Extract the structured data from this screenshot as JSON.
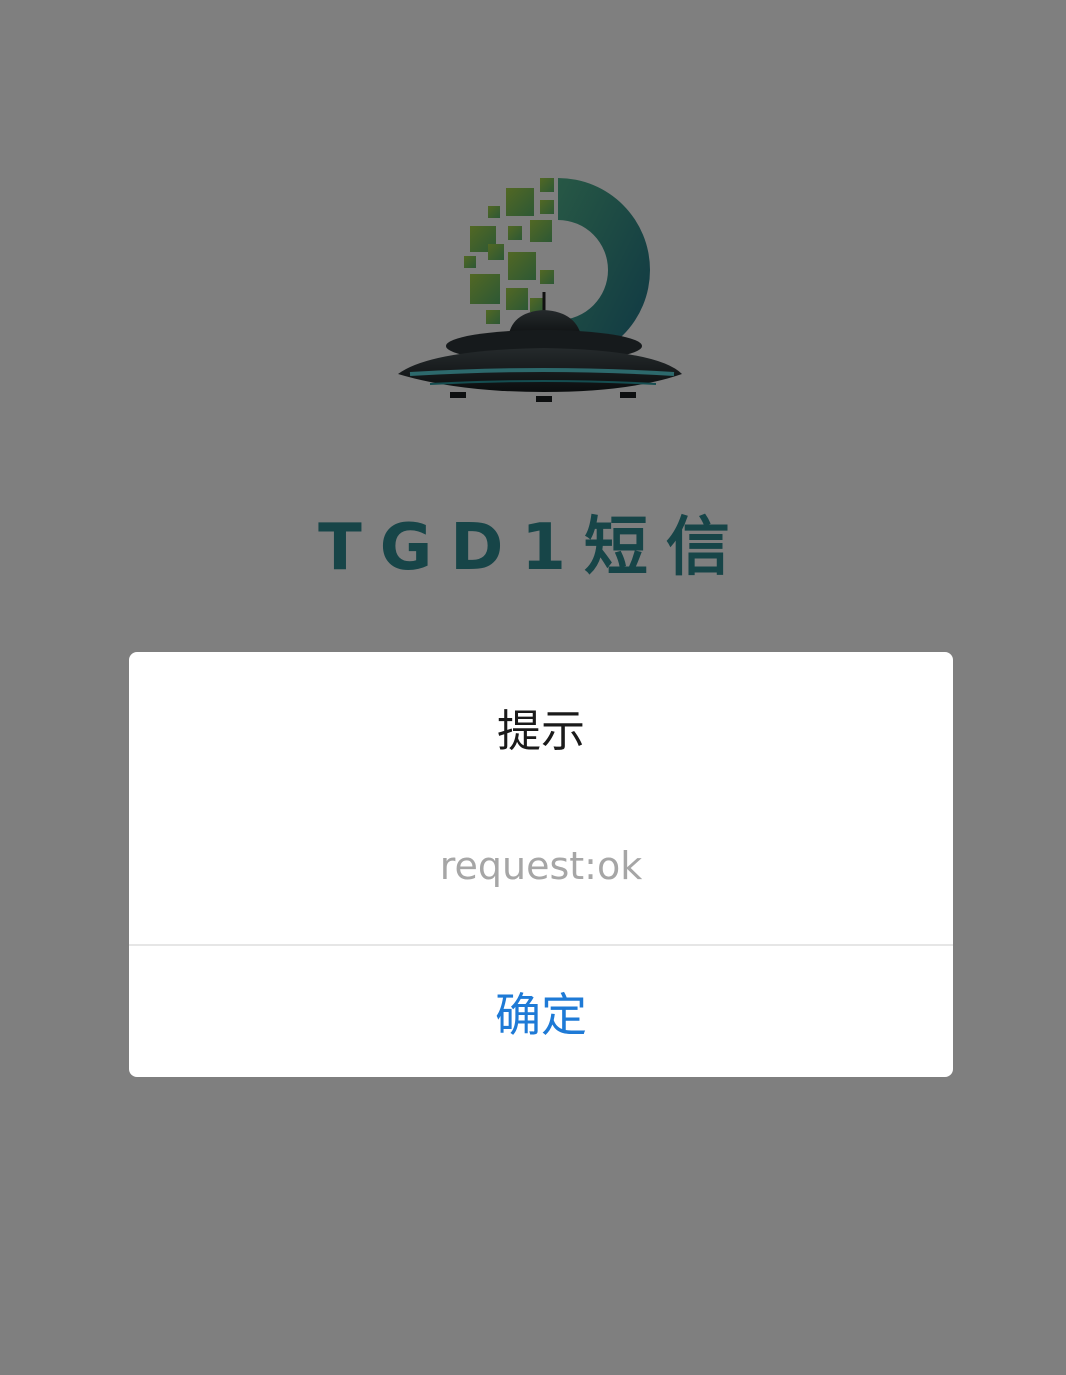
{
  "app": {
    "title": "TGD1短信",
    "title_color": "#2f8a90",
    "logo_icon": "ufo-logo-icon"
  },
  "overlay": {
    "color": "#808080"
  },
  "dialog": {
    "title": "提示",
    "content": "request:ok",
    "content_color": "#a6a6a6",
    "confirm_label": "确定",
    "confirm_color": "#1e7ad6"
  }
}
